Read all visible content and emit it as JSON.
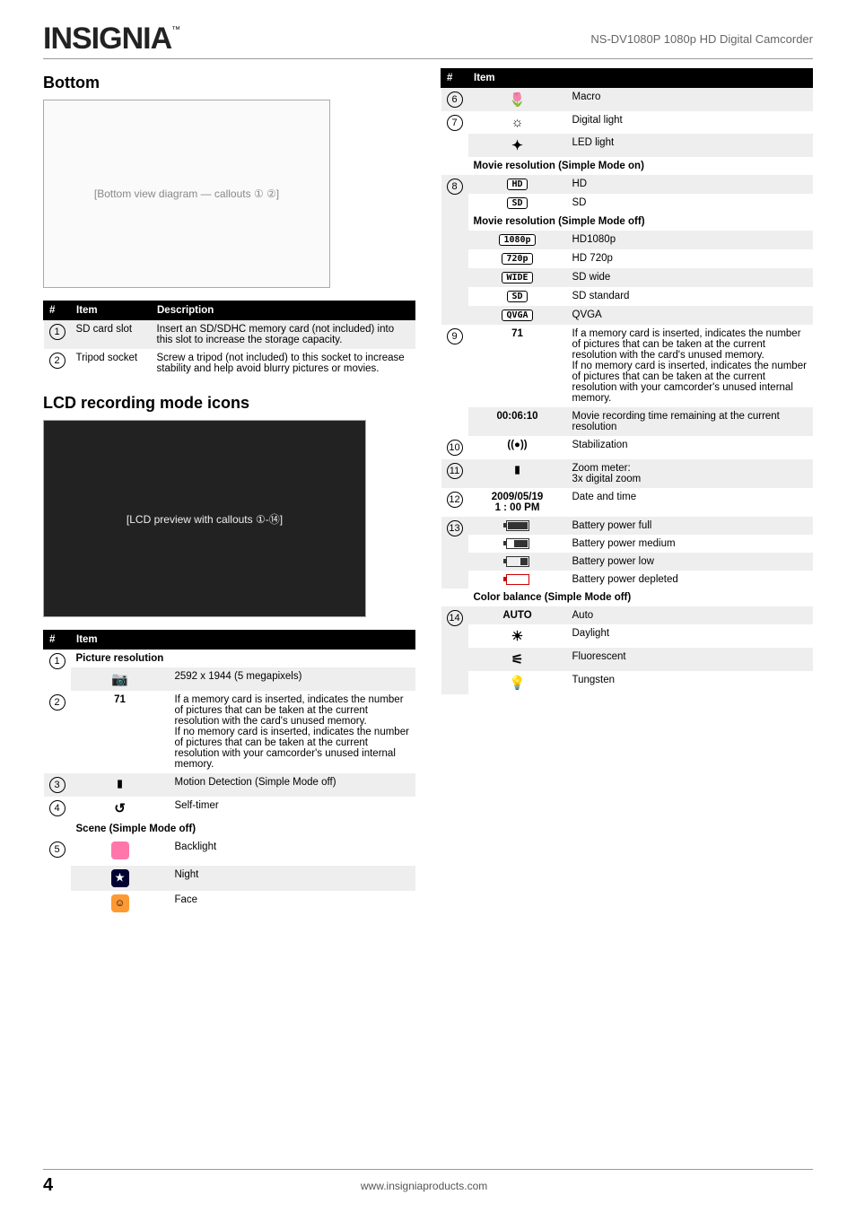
{
  "header": {
    "brand": "INSIGNIA",
    "brand_tm": "™",
    "model": "NS-DV1080P 1080p HD Digital Camcorder"
  },
  "sections": {
    "bottom": "Bottom",
    "lcd": "LCD recording mode icons"
  },
  "bottom_table": {
    "headers": {
      "num": "#",
      "item": "Item",
      "desc": "Description"
    },
    "rows": [
      {
        "num": "1",
        "item": "SD card slot",
        "desc": "Insert an SD/SDHC memory card (not included) into this slot to increase the storage capacity."
      },
      {
        "num": "2",
        "item": "Tripod socket",
        "desc": "Screw a tripod (not included) to this socket to increase stability and help avoid blurry pictures or movies."
      }
    ]
  },
  "items_table": {
    "headers": {
      "num": "#",
      "item": "Item"
    },
    "groups": {
      "picture_res": "Picture resolution",
      "scene_off": "Scene (Simple Mode off)",
      "movie_on": "Movie resolution (Simple Mode on)",
      "movie_off": "Movie resolution (Simple Mode off)",
      "color_off": "Color balance (Simple Mode off)"
    },
    "r1_icon": "📷",
    "r1_desc": "2592 x 1944 (5 megapixels)",
    "r2_num": "2",
    "r2_icon": "71",
    "r2_desc": "If a memory card is inserted, indicates the number of pictures that can be taken at the current resolution with the card's unused memory.\nIf no memory card is inserted, indicates the number of pictures that can be taken at the current resolution with your camcorder's unused internal memory.",
    "r3_num": "3",
    "r3_desc": "Motion Detection (Simple Mode off)",
    "r4_num": "4",
    "r4_icon": "↺",
    "r4_desc": "Self-timer",
    "r5_num": "5",
    "r5a_desc": "Backlight",
    "r5b_desc": "Night",
    "r5c_desc": "Face",
    "r6_num": "6",
    "r6_icon": "🌷",
    "r6_desc": "Macro",
    "r7_num": "7",
    "r7a_icon": "☼",
    "r7a_desc": "Digital light",
    "r7b_icon": "✦",
    "r7b_desc": "LED light",
    "r8_num": "8",
    "r8a_icon": "HD",
    "r8a_desc": "HD",
    "r8b_icon": "SD",
    "r8b_desc": "SD",
    "r8c_icon": "1080p",
    "r8c_desc": "HD1080p",
    "r8d_icon": "720p",
    "r8d_desc": "HD 720p",
    "r8e_icon": "WIDE",
    "r8e_desc": "SD wide",
    "r8f_icon": "SD",
    "r8f_desc": "SD standard",
    "r8g_icon": "QVGA",
    "r8g_desc": "QVGA",
    "r9_num": "9",
    "r9a_icon": "71",
    "r9a_desc": "If a memory card is inserted, indicates the number of pictures that can be taken at the current resolution with the card's unused memory.\nIf no memory card is inserted, indicates the number of pictures that can be taken at the current resolution with your camcorder's unused internal memory.",
    "r9b_icon": "00:06:10",
    "r9b_desc": "Movie recording time remaining at the current resolution",
    "r10_num": "10",
    "r10_icon": "((●))",
    "r10_desc": "Stabilization",
    "r11_num": "11",
    "r11_desc": "Zoom meter:\n3x digital zoom",
    "r12_num": "12",
    "r12_icon": "2009/05/19\n1 : 00 PM",
    "r12_desc": "Date and time",
    "r13_num": "13",
    "r13a_desc": "Battery power full",
    "r13b_desc": "Battery power medium",
    "r13c_desc": "Battery power low",
    "r13d_desc": "Battery power depleted",
    "r14_num": "14",
    "r14a_icon": "AUTO",
    "r14a_desc": "Auto",
    "r14b_icon": "☀",
    "r14b_desc": "Daylight",
    "r14c_icon": "⚟",
    "r14c_desc": "Fluorescent",
    "r14d_icon": "💡",
    "r14d_desc": "Tungsten"
  },
  "illus": {
    "bottom_alt": "[Bottom view diagram — callouts ① ②]",
    "lcd_alt": "[LCD preview with callouts ①‑⑭]"
  },
  "footer": {
    "page": "4",
    "url": "www.insigniaproducts.com"
  }
}
